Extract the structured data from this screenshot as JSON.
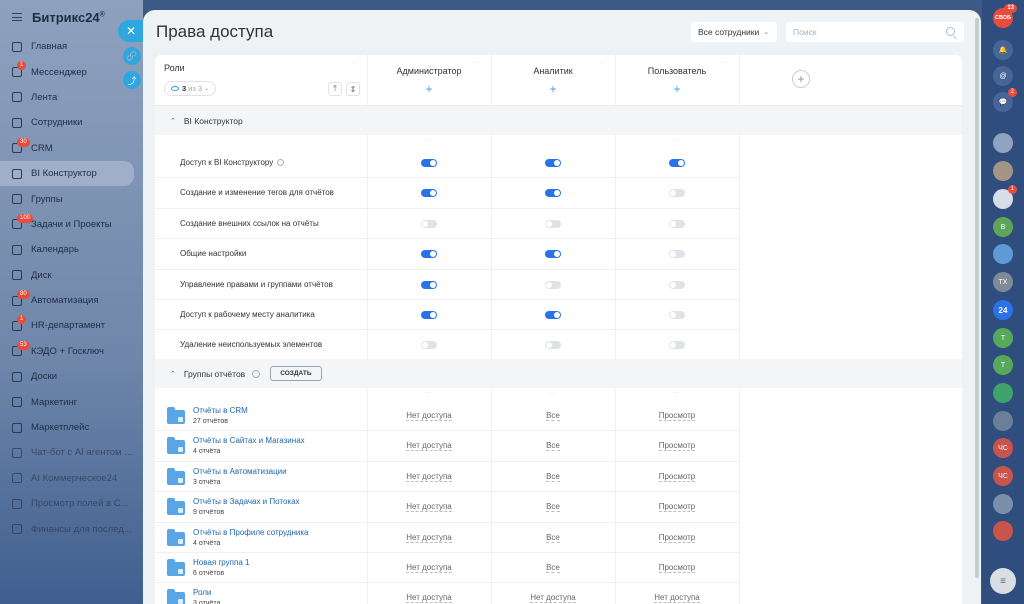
{
  "sidebar": {
    "logo": "Битрикс24",
    "logo_sup": "®",
    "items": [
      {
        "label": "Главная",
        "badge": ""
      },
      {
        "label": "Мессенджер",
        "badge": "1"
      },
      {
        "label": "Лента",
        "badge": ""
      },
      {
        "label": "Сотрудники",
        "badge": ""
      },
      {
        "label": "CRM",
        "badge": "30"
      },
      {
        "label": "BI Конструктор",
        "badge": ""
      },
      {
        "label": "Группы",
        "badge": ""
      },
      {
        "label": "Задачи и Проекты",
        "badge": "100"
      },
      {
        "label": "Календарь",
        "badge": ""
      },
      {
        "label": "Диск",
        "badge": ""
      },
      {
        "label": "Автоматизация",
        "badge": "80"
      },
      {
        "label": "HR-департамент",
        "badge": "1"
      },
      {
        "label": "КЭДО + Госключ",
        "badge": "53"
      },
      {
        "label": "Доски",
        "badge": ""
      },
      {
        "label": "Маркетинг",
        "badge": ""
      },
      {
        "label": "Маркетплейс",
        "badge": ""
      },
      {
        "label": "Чат-бот с AI агентом ...",
        "badge": ""
      },
      {
        "label": "AI Коммерческое24",
        "badge": ""
      },
      {
        "label": "Просмотр полей в С...",
        "badge": ""
      },
      {
        "label": "Финансы для послед...",
        "badge": ""
      }
    ]
  },
  "panel": {
    "close_glyph": "✕",
    "title": "Права доступа",
    "employees_select": "Все сотрудники",
    "search_placeholder": "Поиск"
  },
  "roles": {
    "label": "Роли",
    "count": "3",
    "of_text": "из 3",
    "columns": [
      {
        "name": "Администратор"
      },
      {
        "name": "Аналитик"
      },
      {
        "name": "Пользователь"
      }
    ]
  },
  "bi_section": {
    "title": "BI Конструктор",
    "rows": [
      {
        "label": "Доступ к BI Конструктору",
        "help": true,
        "values": [
          true,
          true,
          true
        ]
      },
      {
        "label": "Создание и изменение тегов для отчётов",
        "help": false,
        "values": [
          true,
          true,
          false
        ]
      },
      {
        "label": "Создание внешних ссылок на отчёты",
        "help": false,
        "values": [
          false,
          false,
          false
        ]
      },
      {
        "label": "Общие настройки",
        "help": false,
        "values": [
          true,
          true,
          false
        ]
      },
      {
        "label": "Управление правами и группами отчётов",
        "help": false,
        "values": [
          true,
          false,
          false
        ]
      },
      {
        "label": "Доступ к рабочему месту аналитика",
        "help": false,
        "values": [
          true,
          true,
          false
        ]
      },
      {
        "label": "Удаление неиспользуемых элементов",
        "help": false,
        "values": [
          false,
          false,
          false
        ]
      }
    ]
  },
  "groups_section": {
    "title": "Группы отчётов",
    "create_label": "СОЗДАТЬ",
    "groups": [
      {
        "name": "Отчёты в CRM",
        "count": "27 отчётов",
        "access": [
          "Нет доступа",
          "Все",
          "Просмотр"
        ]
      },
      {
        "name": "Отчёты в Сайтах и Магазинах",
        "count": "4 отчёта",
        "access": [
          "Нет доступа",
          "Все",
          "Просмотр"
        ]
      },
      {
        "name": "Отчёты в Автоматизации",
        "count": "3 отчёта",
        "access": [
          "Нет доступа",
          "Все",
          "Просмотр"
        ]
      },
      {
        "name": "Отчёты в Задачах и Потоках",
        "count": "9 отчётов",
        "access": [
          "Нет доступа",
          "Все",
          "Просмотр"
        ]
      },
      {
        "name": "Отчёты в Профиле сотрудника",
        "count": "4 отчёта",
        "access": [
          "Нет доступа",
          "Все",
          "Просмотр"
        ]
      },
      {
        "name": "Новая группа 1",
        "count": "6 отчётов",
        "access": [
          "Нет доступа",
          "Все",
          "Просмотр"
        ]
      },
      {
        "name": "Роли",
        "count": "3 отчёта",
        "access": [
          "Нет доступа",
          "Нет доступа",
          "Нет доступа"
        ]
      }
    ]
  },
  "right_rail": {
    "top_badge": "13",
    "top_label": "СВОБ",
    "chat_badge": "2",
    "contact_badge": "1",
    "initials": [
      "В",
      "ТХ",
      "24",
      "Т",
      "Т",
      "ЧС",
      "ЧС"
    ]
  }
}
